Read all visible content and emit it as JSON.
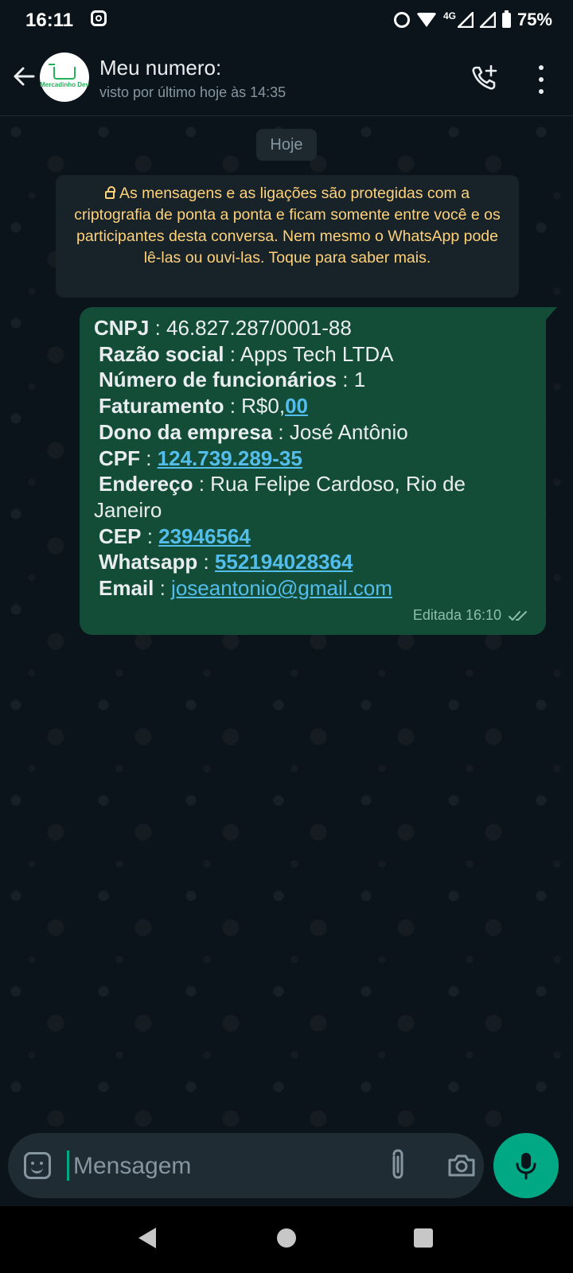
{
  "status_bar": {
    "time": "16:11",
    "network": "4G",
    "battery": "75%"
  },
  "header": {
    "title": "Meu numero:",
    "subtitle": "visto por último hoje às 14:35",
    "avatar_text": "Mercadinho Dev"
  },
  "chat": {
    "date_label": "Hoje",
    "e2e_notice": "As mensagens e as ligações são protegidas com a criptografia de ponta a ponta e ficam somente entre você e os participantes desta conversa. Nem mesmo o WhatsApp pode lê-las ou ouvi-las. Toque para saber mais.",
    "message": {
      "cnpj_label": "CNPJ",
      "cnpj_value": "46.827.287/0001-88",
      "razao_label": "Razão social",
      "razao_value": "Apps Tech LTDA",
      "func_label": "Número de funcionários",
      "func_value": "1",
      "fat_label": "Faturamento",
      "fat_prefix": "R$0,",
      "fat_link": "00",
      "dono_label": "Dono da empresa",
      "dono_value": "José Antônio",
      "cpf_label": "CPF",
      "cpf_value": "124.739.289-35",
      "end_label": "Endereço",
      "end_value": "Rua Felipe Cardoso, Rio de Janeiro",
      "cep_label": "CEP",
      "cep_value": "23946564",
      "whats_label": "Whatsapp",
      "whats_value": "552194028364",
      "email_label": "Email",
      "email_value": "joseantonio@gmail.com",
      "meta": "Editada 16:10",
      "separator": " : "
    }
  },
  "composer": {
    "placeholder": "Mensagem"
  },
  "icons": {
    "back": "arrow-left-icon",
    "call": "add-call-icon",
    "more": "more-vert-icon",
    "emoji": "emoji-icon",
    "attach": "paperclip-icon",
    "camera": "camera-icon",
    "mic": "mic-icon",
    "read_receipt": "double-check-icon"
  },
  "colors": {
    "background": "#0b141a",
    "outgoing_bubble": "#144d37",
    "notice_text": "#ffd279",
    "link": "#53bdeb",
    "accent": "#00a884"
  }
}
